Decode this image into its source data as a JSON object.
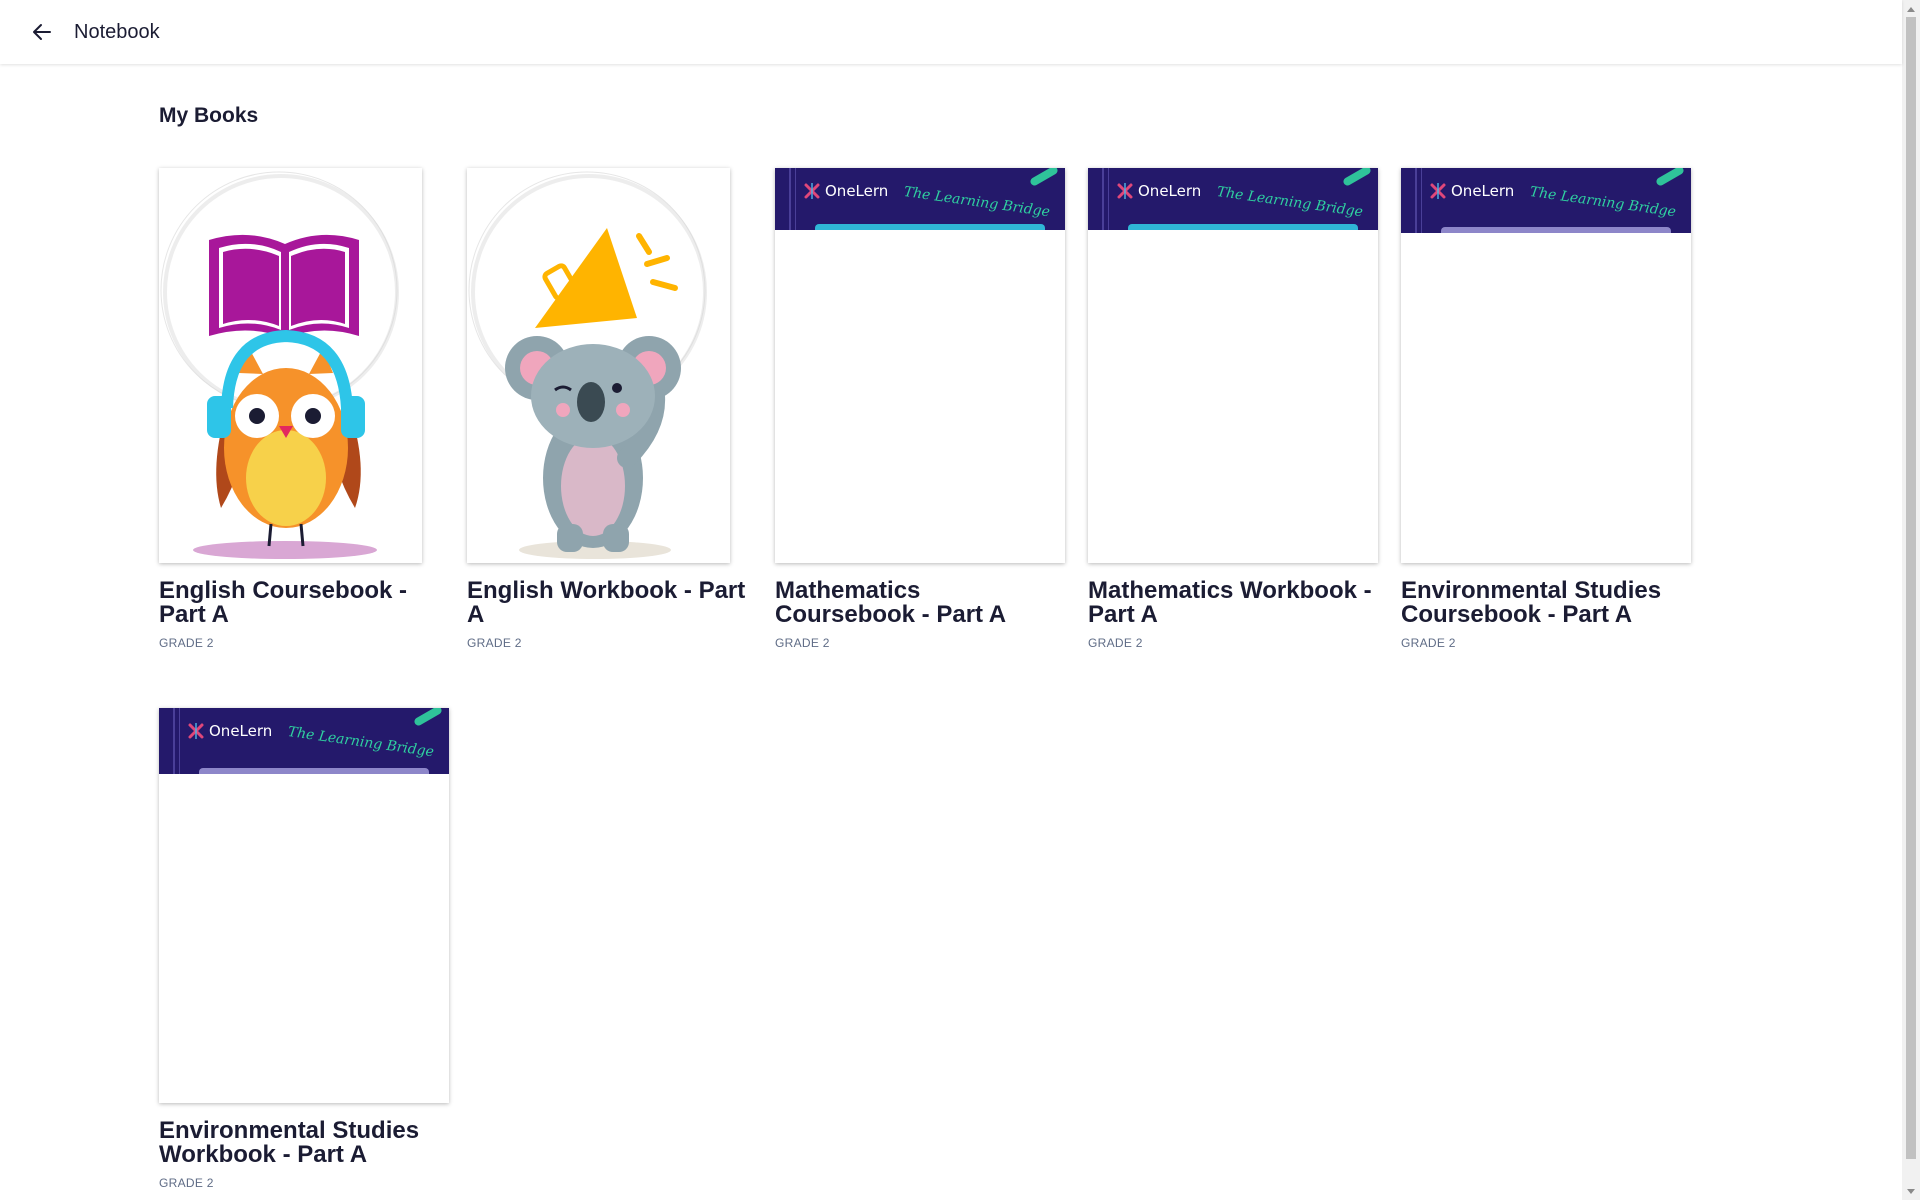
{
  "header": {
    "back_icon": "arrow-left-icon",
    "title": "Notebook"
  },
  "page": {
    "section_title": "My Books"
  },
  "brand": {
    "logo_text": "OneLern",
    "tagline": "The Learning Bridge",
    "banner_color": "#24196b",
    "accent_color": "#2fc39a"
  },
  "books": [
    {
      "title": "English Coursebook - Part A",
      "grade": "GRADE 2",
      "cover": "owl-with-book-illustration"
    },
    {
      "title": "English Workbook - Part A",
      "grade": "GRADE 2",
      "cover": "koala-with-megaphone-illustration"
    },
    {
      "title": "Mathematics Coursebook - Part A",
      "grade": "GRADE 2",
      "cover": "onelern-banner"
    },
    {
      "title": "Mathematics Workbook - Part A",
      "grade": "GRADE 2",
      "cover": "onelern-banner"
    },
    {
      "title": "Environmental Studies Coursebook - Part A",
      "grade": "GRADE 2",
      "cover": "onelern-banner"
    },
    {
      "title": "Environmental Studies Workbook - Part A",
      "grade": "GRADE 2",
      "cover": "onelern-banner"
    }
  ]
}
